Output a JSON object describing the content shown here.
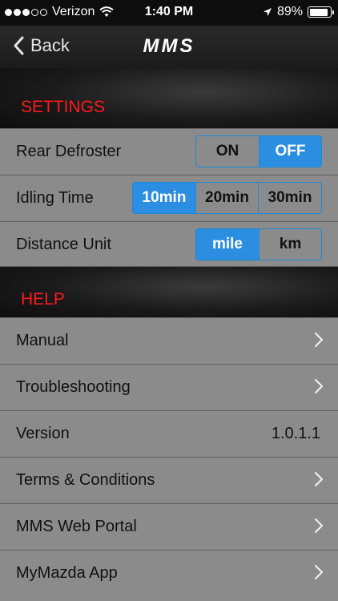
{
  "status_bar": {
    "carrier": "Verizon",
    "time": "1:40 PM",
    "battery_percent": "89%",
    "signal_bars_filled": 3,
    "signal_bars_total": 5,
    "icons": [
      "wifi-icon",
      "location-arrow-icon",
      "battery-icon"
    ]
  },
  "nav": {
    "back_label": "Back",
    "title": "MMS"
  },
  "settings": {
    "header": "SETTINGS",
    "rows": [
      {
        "label": "Rear Defroster",
        "options": [
          "ON",
          "OFF"
        ],
        "selected": "OFF"
      },
      {
        "label": "Idling Time",
        "options": [
          "10min",
          "20min",
          "30min"
        ],
        "selected": "10min"
      },
      {
        "label": "Distance Unit",
        "options": [
          "mile",
          "km"
        ],
        "selected": "mile"
      }
    ]
  },
  "help": {
    "header": "HELP",
    "items": [
      {
        "label": "Manual",
        "has_chevron": true
      },
      {
        "label": "Troubleshooting",
        "has_chevron": true
      },
      {
        "label": "Version",
        "value": "1.0.1.1"
      },
      {
        "label": "Terms & Conditions",
        "has_chevron": true
      },
      {
        "label": "MMS Web Portal",
        "has_chevron": true
      },
      {
        "label": "MyMazda App",
        "has_chevron": true
      }
    ]
  },
  "colors": {
    "section_header_text": "#ff1a1a",
    "segment_selected": "#2c8ee0",
    "segment_border": "#1e88d6",
    "list_background": "#8b8b8b"
  }
}
